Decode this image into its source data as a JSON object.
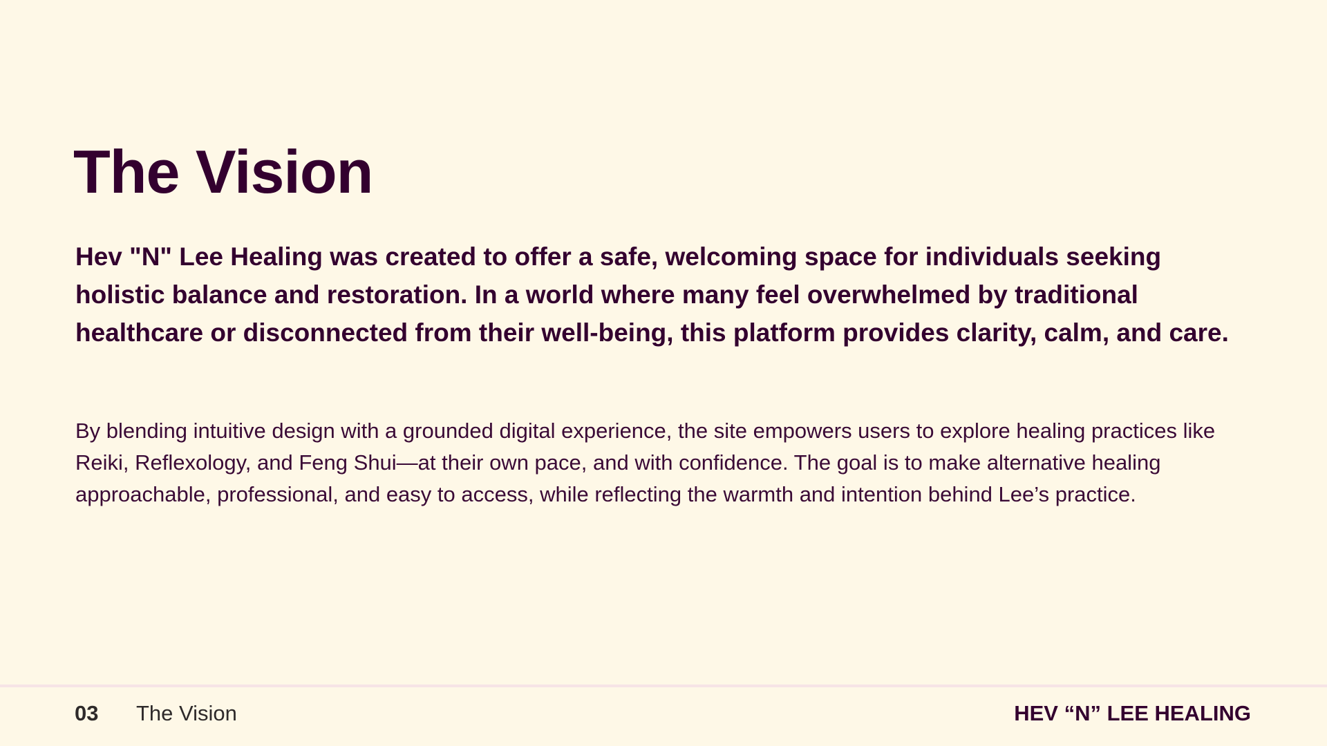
{
  "slide": {
    "title": "The Vision",
    "lead": "Hev \"N\" Lee Healing was created to offer a safe, welcoming space for individuals seeking holistic balance and restoration. In a world where many feel overwhelmed by traditional healthcare or disconnected from their well-being, this platform provides clarity, calm, and care.",
    "body": "By blending intuitive design with a grounded digital experience, the site empowers users to explore healing practices like Reiki, Reflexology, and Feng Shui—at their own pace, and with confidence. The goal is to make alternative healing approachable, professional, and easy to access, while reflecting the warmth and intention behind Lee’s practice."
  },
  "footer": {
    "page_number": "03",
    "section": "The Vision",
    "brand": "HEV “N” LEE HEALING"
  },
  "colors": {
    "background": "#fef8e7",
    "text": "#33002f",
    "divider": "#f6e4e6"
  }
}
